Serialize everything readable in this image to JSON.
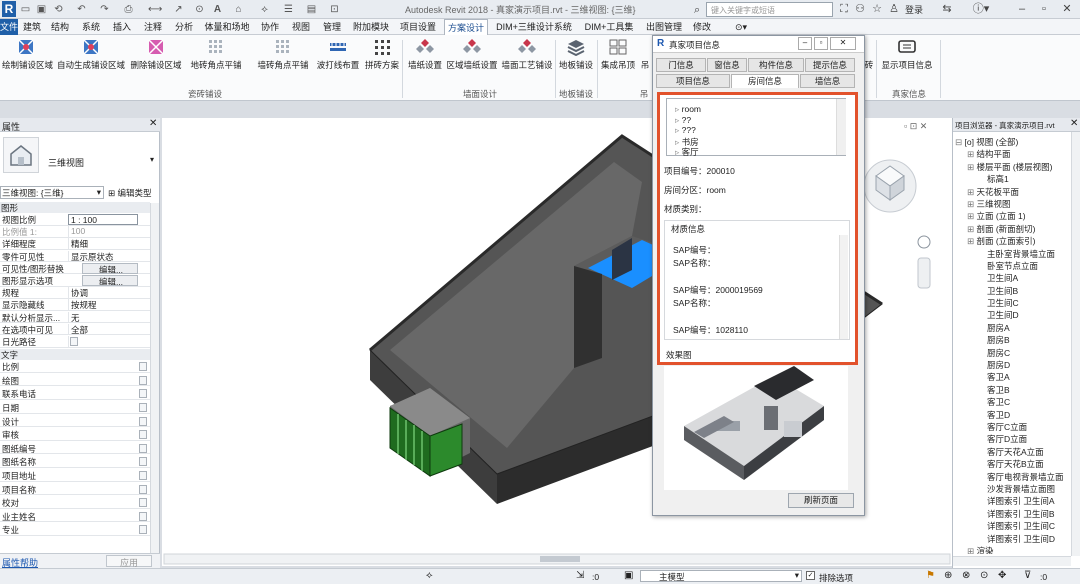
{
  "app": {
    "logo": "R",
    "title": "Autodesk Revit 2018 -    真家演示项目.rvt - 三维视图: {三维}",
    "search_placeholder": "键入关键字或短语",
    "login": "登录"
  },
  "tabs": [
    "文件",
    "建筑",
    "结构",
    "系统",
    "插入",
    "注释",
    "分析",
    "体量和场地",
    "协作",
    "视图",
    "管理",
    "附加模块",
    "项目设置",
    "方案设计",
    "DIM+三维设计系统",
    "DIM+工具集",
    "出图管理",
    "修改"
  ],
  "active_tab": "方案设计",
  "ribbon": {
    "buttons": [
      "绘制铺设区域",
      "自动生成铺设区域",
      "删除铺设区域",
      "地砖角点平铺",
      "墙砖角点平铺",
      "波打线布置",
      "拼砖方案",
      "墙纸设置",
      "区域墙纸设置",
      "墙面工艺铺设",
      "地板铺设",
      "集成吊顶",
      "吊",
      "砖",
      "显示项目信息"
    ],
    "panels": [
      "瓷砖铺设",
      "墙面设计",
      "地板铺设",
      "吊",
      "真家信息"
    ]
  },
  "properties": {
    "title": "属性",
    "type_name": "三维视图",
    "selector": "三维视图: {三维}",
    "edit_type": "编辑类型",
    "group_graphics": "图形",
    "rows": [
      {
        "k": "视图比例",
        "v": "1 : 100"
      },
      {
        "k": "比例值 1:",
        "v": "100"
      },
      {
        "k": "详细程度",
        "v": "精细"
      },
      {
        "k": "零件可见性",
        "v": "显示原状态"
      },
      {
        "k": "可见性/图形替换",
        "v": "编辑..."
      },
      {
        "k": "图形显示选项",
        "v": "编辑..."
      },
      {
        "k": "规程",
        "v": "协调"
      },
      {
        "k": "显示隐藏线",
        "v": "按规程"
      },
      {
        "k": "默认分析显示...",
        "v": "无"
      },
      {
        "k": "在选项中可见",
        "v": "全部"
      },
      {
        "k": "日光路径",
        "v": ""
      }
    ],
    "group_text": "文字",
    "text_rows": [
      "比例",
      "绘图",
      "联系电话",
      "日期",
      "设计",
      "审核",
      "图纸编号",
      "图纸名称",
      "项目地址",
      "项目名称",
      "校对",
      "业主姓名",
      "专业"
    ],
    "help_link": "属性帮助",
    "apply": "应用"
  },
  "browser": {
    "title": "项目浏览器 - 真家演示项目.rvt",
    "items": [
      {
        "t": "[o] 视图 (全部)",
        "lvl": 0
      },
      {
        "t": "结构平面",
        "lvl": 1
      },
      {
        "t": "楼层平面 (楼层视图)",
        "lvl": 1
      },
      {
        "t": "标高1",
        "lvl": 2
      },
      {
        "t": "天花板平面",
        "lvl": 1
      },
      {
        "t": "三维视图",
        "lvl": 1
      },
      {
        "t": "立面 (立面 1)",
        "lvl": 1
      },
      {
        "t": "剖面 (新面剖切)",
        "lvl": 1
      },
      {
        "t": "剖面 (立面索引)",
        "lvl": 1
      },
      {
        "t": "主卧室背景墙立面",
        "lvl": 2
      },
      {
        "t": "卧室节点立面",
        "lvl": 2
      },
      {
        "t": "卫生间A",
        "lvl": 2
      },
      {
        "t": "卫生间B",
        "lvl": 2
      },
      {
        "t": "卫生间C",
        "lvl": 2
      },
      {
        "t": "卫生间D",
        "lvl": 2
      },
      {
        "t": "厨房A",
        "lvl": 2
      },
      {
        "t": "厨房B",
        "lvl": 2
      },
      {
        "t": "厨房C",
        "lvl": 2
      },
      {
        "t": "厨房D",
        "lvl": 2
      },
      {
        "t": "客卫A",
        "lvl": 2
      },
      {
        "t": "客卫B",
        "lvl": 2
      },
      {
        "t": "客卫C",
        "lvl": 2
      },
      {
        "t": "客卫D",
        "lvl": 2
      },
      {
        "t": "客厅C立面",
        "lvl": 2
      },
      {
        "t": "客厅D立面",
        "lvl": 2
      },
      {
        "t": "客厅天花A立面",
        "lvl": 2
      },
      {
        "t": "客厅天花B立面",
        "lvl": 2
      },
      {
        "t": "客厅电视背景墙立面",
        "lvl": 2
      },
      {
        "t": "沙发背景墙立面图",
        "lvl": 2
      },
      {
        "t": "详图索引 卫生间A",
        "lvl": 2
      },
      {
        "t": "详图索引 卫生间B",
        "lvl": 2
      },
      {
        "t": "详图索引 卫生间C",
        "lvl": 2
      },
      {
        "t": "详图索引 卫生间D",
        "lvl": 2
      },
      {
        "t": "渲染",
        "lvl": 1
      }
    ]
  },
  "dialog": {
    "logo": "R",
    "title": "真家项目信息",
    "tabs_row1": [
      "门信息",
      "窗信息",
      "构件信息",
      "提示信息"
    ],
    "tabs_row2": [
      "项目信息",
      "房间信息",
      "墙信息"
    ],
    "active_tab": "房间信息",
    "tree": [
      "room",
      "??",
      "???",
      "书房",
      "客厅"
    ],
    "project_no": "项目编号：200010",
    "room_zone": "房间分区：room",
    "material_type": "材质类别：",
    "material_box_title": "材质信息",
    "material_lines": [
      "SAP编号：",
      "SAP名称：",
      "",
      "SAP编号：2000019569",
      "SAP名称：",
      "",
      "SAP编号：1028110"
    ],
    "effect_label": "效果图",
    "refresh": "刷新页面"
  },
  "status": {
    "scale_value": ":0",
    "model": "主模型",
    "exclude": "排除选项",
    "filter_value": ":0"
  },
  "colors": {
    "accent": "#1d4f91",
    "red_frame": "#e2522c",
    "pool": "#1a8fff"
  }
}
